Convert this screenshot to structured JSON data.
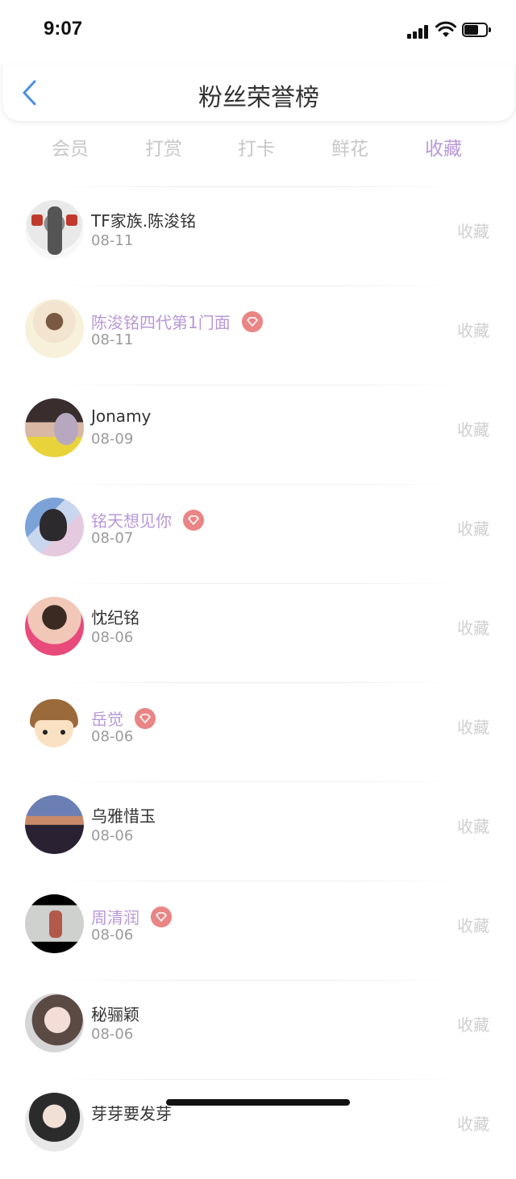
{
  "status_bar": {
    "time": "9:07"
  },
  "nav": {
    "title": "粉丝荣誉榜"
  },
  "tabs": [
    {
      "label": "会员",
      "active": false
    },
    {
      "label": "打赏",
      "active": false
    },
    {
      "label": "打卡",
      "active": false
    },
    {
      "label": "鲜花",
      "active": false
    },
    {
      "label": "收藏",
      "active": true
    }
  ],
  "colors": {
    "accent": "#b89ad9",
    "vip_name": "#b898d8",
    "vip_badge": "#ea8585",
    "back": "#4a90e2"
  },
  "fans": [
    {
      "name": "TF家族.陈浚铭",
      "date": "08-11",
      "action": "收藏",
      "vip": false
    },
    {
      "name": "陈浚铭四代第1门面",
      "date": "08-11",
      "action": "收藏",
      "vip": true
    },
    {
      "name": "Jonamy",
      "date": "08-09",
      "action": "收藏",
      "vip": false
    },
    {
      "name": "铭天想见你",
      "date": "08-07",
      "action": "收藏",
      "vip": true
    },
    {
      "name": "忱纪铭",
      "date": "08-06",
      "action": "收藏",
      "vip": false
    },
    {
      "name": "岳觉",
      "date": "08-06",
      "action": "收藏",
      "vip": true
    },
    {
      "name": "乌雅惜玉",
      "date": "08-06",
      "action": "收藏",
      "vip": false
    },
    {
      "name": "周清润",
      "date": "08-06",
      "action": "收藏",
      "vip": true
    },
    {
      "name": "秘骊颖",
      "date": "08-06",
      "action": "收藏",
      "vip": false
    },
    {
      "name": "芽芽要发芽",
      "date": "",
      "action": "收藏",
      "vip": false
    }
  ]
}
